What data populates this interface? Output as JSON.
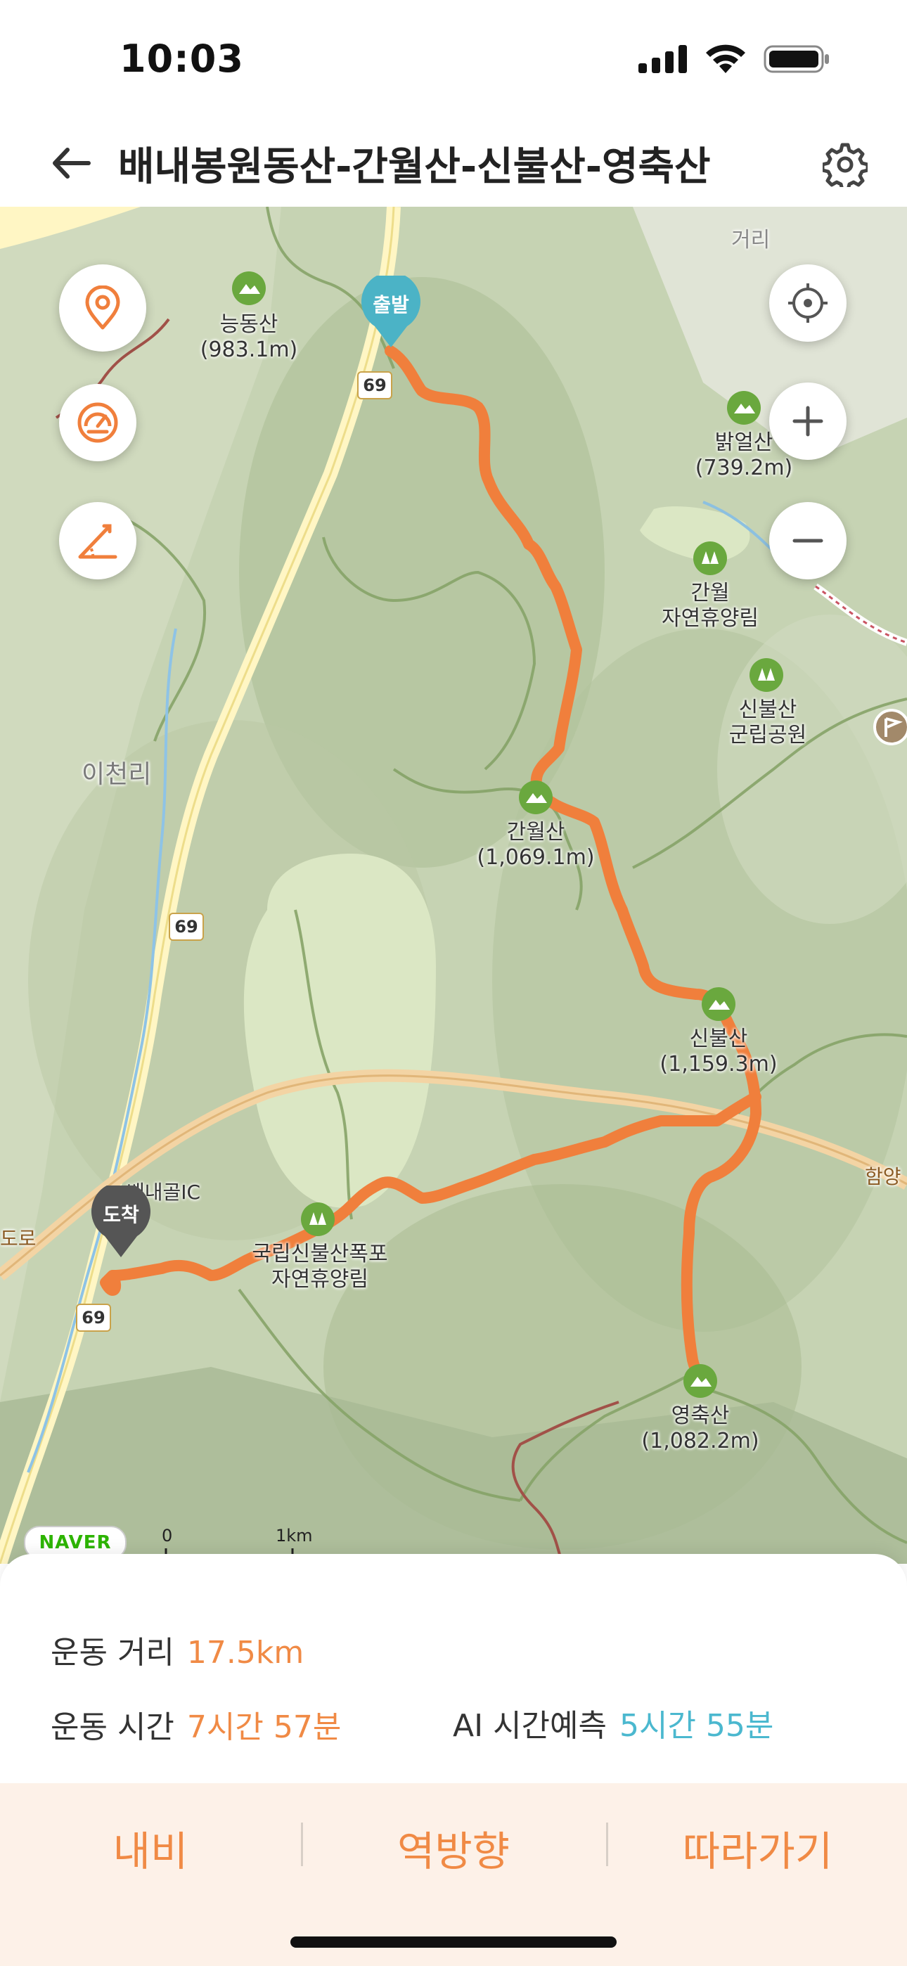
{
  "status_bar": {
    "time": "10:03"
  },
  "header": {
    "title": "배내봉원동산-간월산-신불산-영축산"
  },
  "map": {
    "start_label": "출발",
    "end_label": "도착",
    "area_labels": {
      "distance_hint": "거리",
      "village": "이천리",
      "ic": "배내골IC",
      "road_east": "함양",
      "road_west": "도로"
    },
    "route_numbers": {
      "top": "69",
      "middle": "69",
      "bottom": "69"
    },
    "peaks": [
      {
        "name": "능동산",
        "height": "(983.1m)"
      },
      {
        "name": "밝얼산",
        "height": "(739.2m)"
      },
      {
        "name": "간월",
        "height": "자연휴양림"
      },
      {
        "name": "신불산",
        "height": "군립공원"
      },
      {
        "name": "간월산",
        "height": "(1,069.1m)"
      },
      {
        "name": "신불산",
        "height": "(1,159.3m)"
      },
      {
        "name": "국립신불산폭포",
        "height": "자연휴양림"
      },
      {
        "name": "영축산",
        "height": "(1,082.2m)"
      }
    ],
    "naver_logo": "NAVER",
    "scale": {
      "min": "0",
      "max": "1km"
    },
    "colors": {
      "route": "#f07f3c",
      "start_pin": "#4bb3c6",
      "end_pin": "#555555",
      "peak_marker": "#6aa83e"
    }
  },
  "info": {
    "distance": {
      "label": "운동 거리",
      "value": "17.5km"
    },
    "time": {
      "label": "운동 시간",
      "value": "7시간 57분"
    },
    "ai": {
      "label": "AI 시간예측",
      "value": "5시간 55분"
    }
  },
  "actions": {
    "navi": "내비",
    "reverse": "역방향",
    "follow": "따라가기"
  }
}
